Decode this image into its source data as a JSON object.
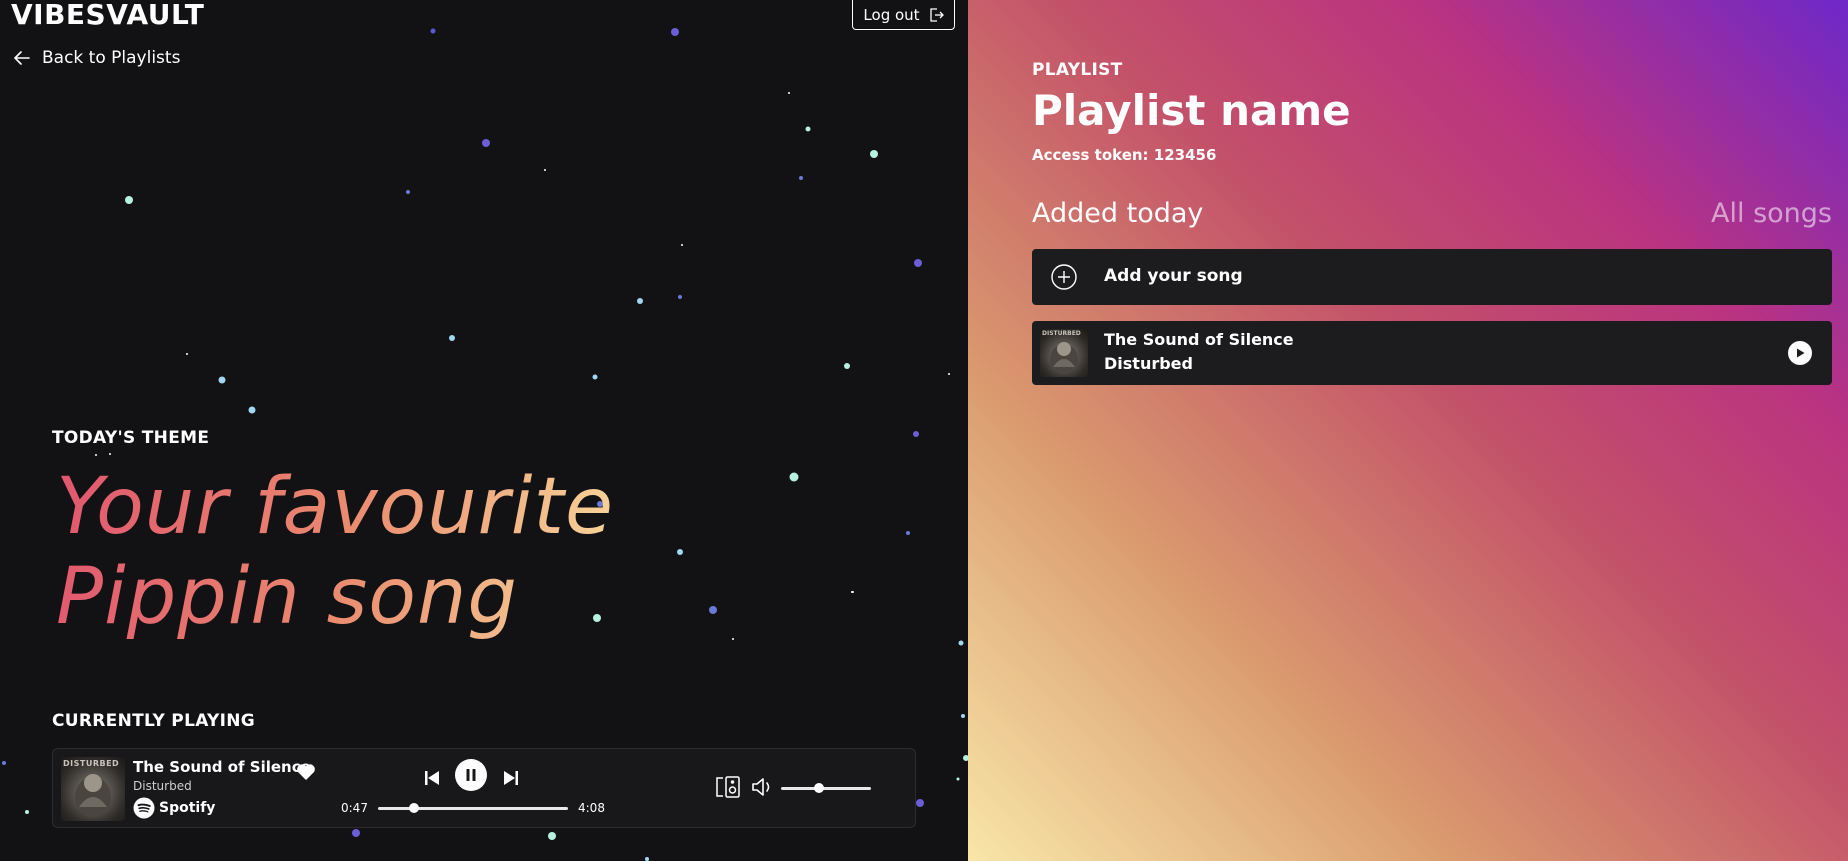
{
  "app": {
    "logo": "VIBESVAULT",
    "logout_label": "Log out",
    "back_label": "Back to Playlists"
  },
  "theme": {
    "label": "TODAY'S THEME",
    "line1": "Your favourite",
    "line2": "Pippin song"
  },
  "player": {
    "section_label": "CURRENTLY PLAYING",
    "album_text": "DISTURBED",
    "title": "The Sound of Silence",
    "artist": "Disturbed",
    "source": "Spotify",
    "current_time": "0:47",
    "total_time": "4:08",
    "progress_fraction": 0.19,
    "volume_fraction": 0.42,
    "is_playing": true,
    "liked": true
  },
  "playlist": {
    "label": "PLAYLIST",
    "name": "Playlist name",
    "access_token": "Access token: 123456",
    "tabs": {
      "added_today": "Added today",
      "all_songs": "All songs"
    },
    "add_song_label": "Add your song",
    "songs": [
      {
        "title": "The Sound of Silence",
        "artist": "Disturbed",
        "album_text": "DISTURBED"
      }
    ]
  },
  "colors": {
    "background": "#121215",
    "player_bg": "#18181b",
    "row_bg": "#1c1c1f",
    "theme_gradient_start": "#e0566f",
    "theme_gradient_end": "#f7d79a",
    "panel_gradient_start": "#f8e6a8",
    "panel_gradient_end": "#6e28c8"
  }
}
